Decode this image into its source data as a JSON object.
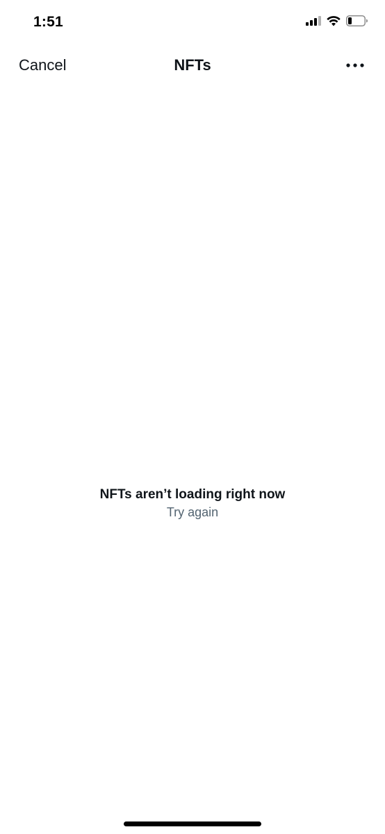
{
  "status_bar": {
    "time": "1:51",
    "icons": [
      "signal-icon",
      "wifi-icon",
      "battery-icon"
    ]
  },
  "header": {
    "cancel_label": "Cancel",
    "title": "NFTs",
    "more_icon": "more-horizontal-icon"
  },
  "empty_state": {
    "title": "NFTs aren’t loading right now",
    "action_label": "Try again"
  },
  "colors": {
    "text_primary": "#0f1419",
    "text_secondary": "#536471",
    "background": "#ffffff"
  }
}
